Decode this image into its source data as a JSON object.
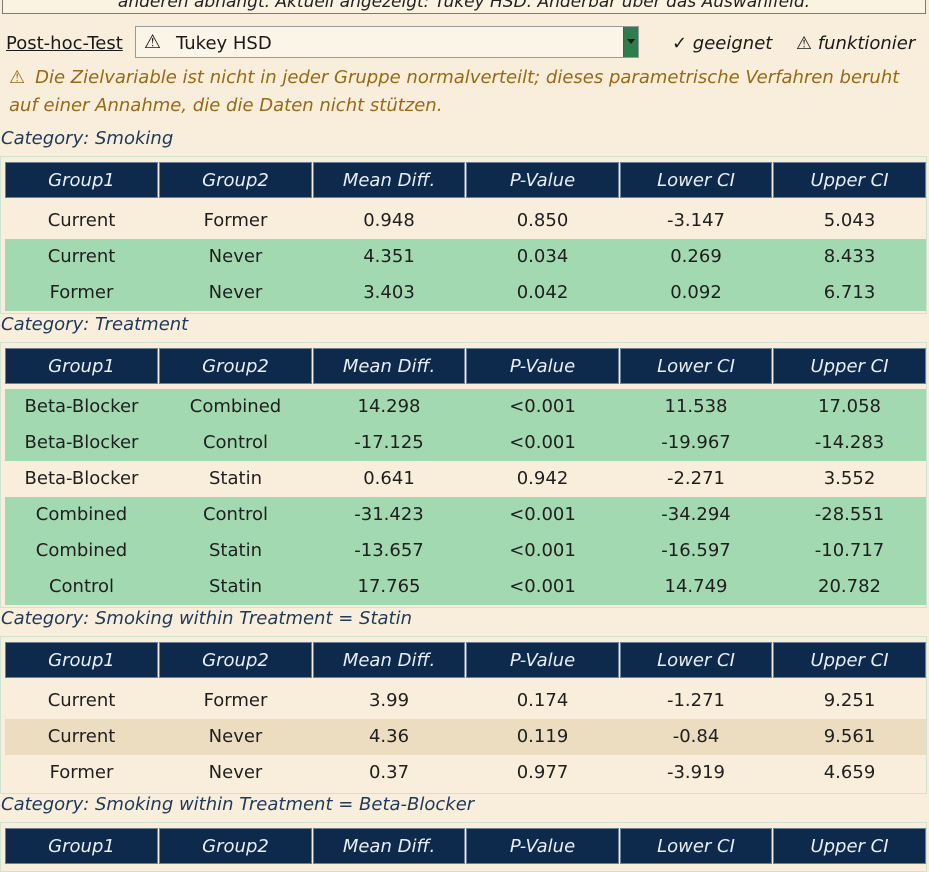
{
  "top_note": "anderen abhängt. Aktuell angezeigt: Tukey HSD. Änderbar über das Auswahlfeld.",
  "posthoc": {
    "label": "Post-hoc-Test",
    "selected": "Tukey HSD",
    "legend_suitable": "✓ geeignet",
    "legend_works": "⚠ funktionier"
  },
  "warning_text": "Die Zielvariable ist nicht in jeder Gruppe normalverteilt; dieses parametrische Verfahren beruht auf einer Annahme, die die Daten nicht stützen.",
  "columns": [
    "Group1",
    "Group2",
    "Mean Diff.",
    "P-Value",
    "Lower CI",
    "Upper CI"
  ],
  "sections": [
    {
      "title": "Category: Smoking",
      "rows": [
        {
          "cells": [
            "Current",
            "Former",
            "0.948",
            "0.850",
            "-3.147",
            "5.043"
          ],
          "style": "plain"
        },
        {
          "cells": [
            "Current",
            "Never",
            "4.351",
            "0.034",
            "0.269",
            "8.433"
          ],
          "style": "sig"
        },
        {
          "cells": [
            "Former",
            "Never",
            "3.403",
            "0.042",
            "0.092",
            "6.713"
          ],
          "style": "sig"
        }
      ]
    },
    {
      "title": "Category: Treatment",
      "rows": [
        {
          "cells": [
            "Beta-Blocker",
            "Combined",
            "14.298",
            "<0.001",
            "11.538",
            "17.058"
          ],
          "style": "sig"
        },
        {
          "cells": [
            "Beta-Blocker",
            "Control",
            "-17.125",
            "<0.001",
            "-19.967",
            "-14.283"
          ],
          "style": "sig"
        },
        {
          "cells": [
            "Beta-Blocker",
            "Statin",
            "0.641",
            "0.942",
            "-2.271",
            "3.552"
          ],
          "style": "plain"
        },
        {
          "cells": [
            "Combined",
            "Control",
            "-31.423",
            "<0.001",
            "-34.294",
            "-28.551"
          ],
          "style": "sig"
        },
        {
          "cells": [
            "Combined",
            "Statin",
            "-13.657",
            "<0.001",
            "-16.597",
            "-10.717"
          ],
          "style": "sig"
        },
        {
          "cells": [
            "Control",
            "Statin",
            "17.765",
            "<0.001",
            "14.749",
            "20.782"
          ],
          "style": "sig"
        }
      ]
    },
    {
      "title": "Category: Smoking within Treatment = Statin",
      "rows": [
        {
          "cells": [
            "Current",
            "Former",
            "3.99",
            "0.174",
            "-1.271",
            "9.251"
          ],
          "style": "plain"
        },
        {
          "cells": [
            "Current",
            "Never",
            "4.36",
            "0.119",
            "-0.84",
            "9.561"
          ],
          "style": "mid"
        },
        {
          "cells": [
            "Former",
            "Never",
            "0.37",
            "0.977",
            "-3.919",
            "4.659"
          ],
          "style": "plain"
        }
      ]
    },
    {
      "title": "Category: Smoking within Treatment = Beta-Blocker",
      "rows": []
    }
  ],
  "colors": {
    "background": "#f8eedb",
    "header": "#0d2a4d",
    "significant_row": "#a3d9b1",
    "marginal_row": "#ecdcc0",
    "warning_text": "#9a6a12",
    "category_title": "#1e3a5a"
  }
}
